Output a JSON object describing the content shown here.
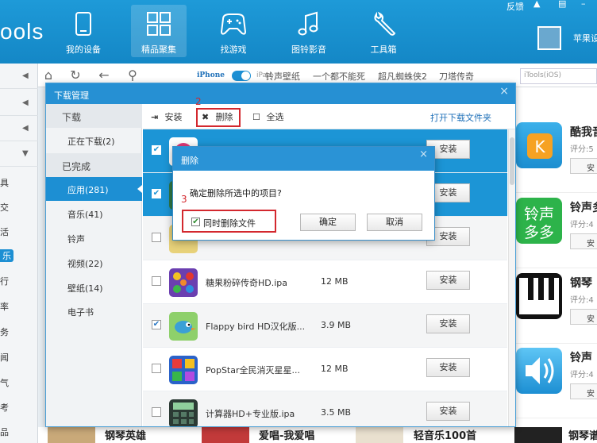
{
  "topbar": {
    "logo_fragment": "ools",
    "nav": [
      {
        "label": "我的设备",
        "icon": "phone-icon"
      },
      {
        "label": "精品聚集",
        "icon": "apps-grid-icon"
      },
      {
        "label": "找游戏",
        "icon": "gamepad-icon"
      },
      {
        "label": "图铃影音",
        "icon": "music-note-icon"
      },
      {
        "label": "工具箱",
        "icon": "wrench-icon"
      }
    ],
    "feedback_label": "反馈",
    "user_name": "苹果设"
  },
  "browserbar": {
    "iphone_label": "iPhone",
    "ipad_label": "iPad",
    "links": [
      "铃声壁纸",
      "一个都不能死",
      "超凡蜘蛛侠2",
      "刀塔传奇"
    ],
    "search_placeholder": "iTools(iOS)"
  },
  "leftstrip": {
    "chars": [
      "具",
      "交",
      "活",
      "乐",
      "行",
      "率",
      "务",
      "闻",
      "气",
      "考",
      "品"
    ]
  },
  "download_manager": {
    "title": "下载管理",
    "sidebar": {
      "download_header": "下载",
      "downloading": "正在下载(2)",
      "completed_header": "已完成",
      "categories": [
        "应用(281)",
        "音乐(41)",
        "铃声",
        "视频(22)",
        "壁纸(14)",
        "电子书"
      ]
    },
    "toolbar": {
      "install": "安装",
      "delete": "删除",
      "select_all": "全选",
      "open_folder": "打开下载文件夹"
    },
    "annotations": {
      "step2": "2",
      "step3": "3"
    },
    "rows": [
      {
        "name": "",
        "size": "",
        "checked": true,
        "button": "安装"
      },
      {
        "name": "",
        "size": "",
        "checked": true,
        "button": "安装"
      },
      {
        "name": "",
        "size": "",
        "checked": false,
        "button": "安装"
      },
      {
        "name": "糖果粉碎传奇HD.ipa",
        "size": "12 MB",
        "checked": false,
        "button": "安装"
      },
      {
        "name": "Flappy bird HD汉化版...",
        "size": "3.9 MB",
        "checked": true,
        "button": "安装"
      },
      {
        "name": "PopStar全民消灭星星...",
        "size": "12 MB",
        "checked": false,
        "button": "安装"
      },
      {
        "name": "计算器HD+专业版.ipa",
        "size": "3.5 MB",
        "checked": false,
        "button": "安装"
      }
    ]
  },
  "confirm_dialog": {
    "title": "删除",
    "message": "确定删除所选中的项目?",
    "checkbox_label": "同时删除文件",
    "checkbox_checked": true,
    "ok": "确定",
    "cancel": "取消"
  },
  "right_apps": [
    {
      "name": "酷我音",
      "score": "评分:5",
      "button": "安"
    },
    {
      "name": "铃声多",
      "score": "评分:4",
      "button": "安"
    },
    {
      "name": "钢琴",
      "score": "评分:4",
      "button": "安"
    },
    {
      "name": "铃声",
      "score": "评分:4",
      "button": "安"
    }
  ],
  "bottom_items": [
    "钢琴英雄",
    "爱唱-我爱唱",
    "轻音乐100首",
    "钢琴谱"
  ],
  "colors": {
    "accent": "#1d8fd3",
    "annotation_red": "#d3282e"
  }
}
